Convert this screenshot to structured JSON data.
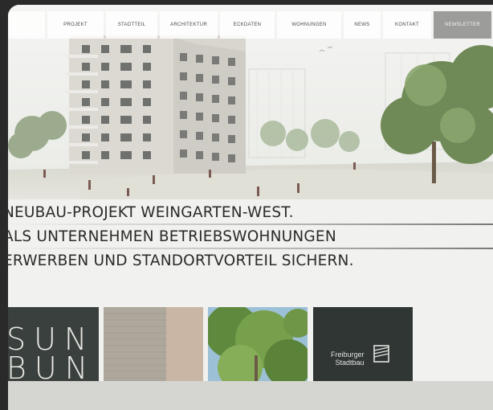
{
  "nav": {
    "items": [
      {
        "label": "PROJEKT",
        "active": false
      },
      {
        "label": "STADTTEIL",
        "active": false
      },
      {
        "label": "ARCHITEKTUR",
        "active": false
      },
      {
        "label": "ECKDATEN",
        "active": false
      },
      {
        "label": "WOHNUNGEN",
        "active": false
      },
      {
        "label": "NEWS",
        "active": false
      },
      {
        "label": "KONTAKT",
        "active": false
      },
      {
        "label": "NEWSLETTER",
        "active": true
      }
    ]
  },
  "headline": {
    "line1": "NEUBAU-PROJEKT WEINGARTEN-WEST.",
    "line2": "ALS UNTERNEHMEN BETRIEBSWOHNUNGEN",
    "line3": "ERWERBEN UND STANDORTVORTEIL SICHERN."
  },
  "tiles": {
    "sunbun": {
      "line1": "SUN",
      "line2": "BUN"
    },
    "stadtbau": {
      "line1": "Freiburger",
      "line2": "Stadtbau",
      "icon": "stadtbau-logo-icon"
    }
  },
  "colors": {
    "nav_active": "#9c9c9a",
    "page_background": "#f1f1ef",
    "tile_dark": "#3a403d",
    "text_dark": "#2b2b2b"
  }
}
